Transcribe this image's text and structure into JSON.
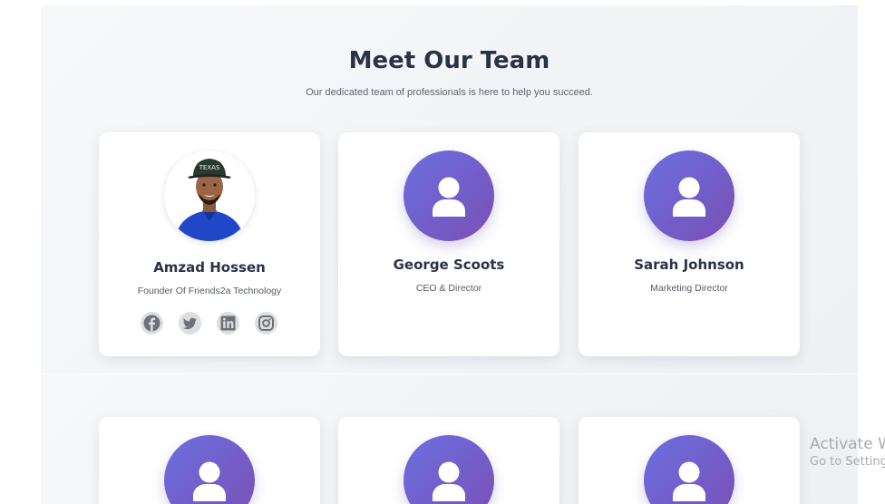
{
  "team_section": {
    "title": "Meet Our Team",
    "subtitle": "Our dedicated team of professionals is here to help you succeed."
  },
  "members": [
    {
      "name": "Amzad Hossen",
      "role": "Founder Of Friends2a Technology",
      "avatar": "photo",
      "socials": [
        "facebook-icon",
        "twitter-icon",
        "linkedin-icon",
        "instagram-icon"
      ]
    },
    {
      "name": "George Scoots",
      "role": "CEO & Director",
      "avatar": "user-placeholder-icon"
    },
    {
      "name": "Sarah Johnson",
      "role": "Marketing Director",
      "avatar": "user-placeholder-icon"
    }
  ],
  "next_row": [
    {
      "avatar": "user-placeholder-icon"
    },
    {
      "avatar": "user-placeholder-icon"
    },
    {
      "avatar": "user-placeholder-icon"
    }
  ],
  "watermark": {
    "line1": "Activate W",
    "line2": "Go to Setting"
  },
  "colors": {
    "heading": "#2a3346",
    "avatar_gradient_start": "#6b6fe0",
    "avatar_gradient_end": "#7a4fb5",
    "social_bg": "#dcdee2",
    "social_fg": "#6e7178"
  }
}
